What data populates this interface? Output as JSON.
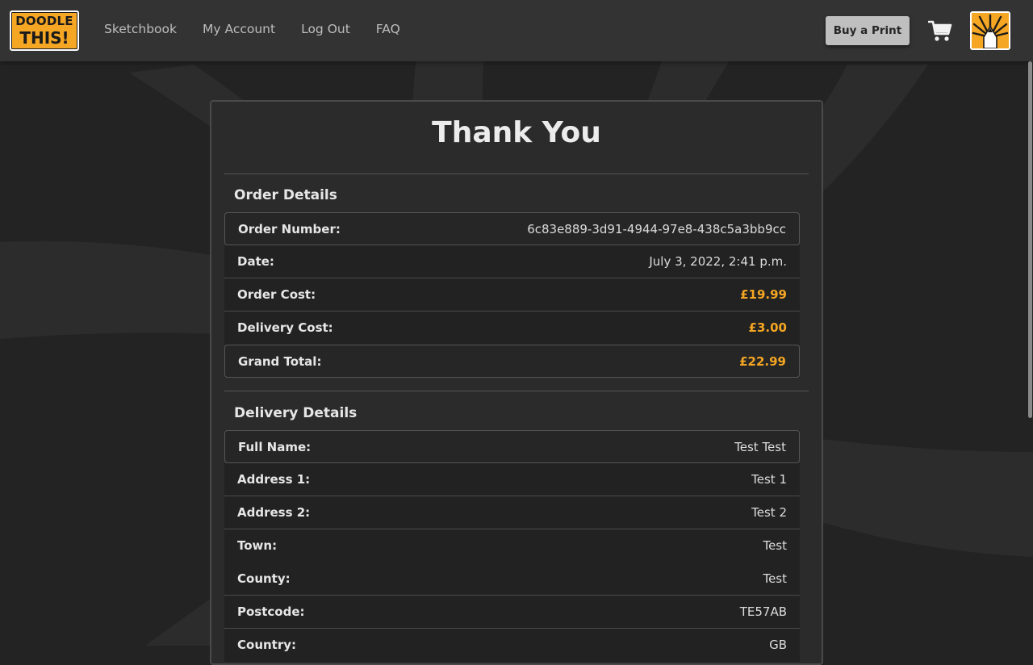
{
  "brand": {
    "line1": "DOODLE",
    "line2": "THIS!",
    "accent": "#f5a623"
  },
  "nav": {
    "links": [
      "Sketchbook",
      "My Account",
      "Log Out",
      "FAQ"
    ],
    "buy_label": "Buy a Print",
    "cart_icon": "cart-icon",
    "avatar_icon": "sunburst-pencil-icon"
  },
  "page": {
    "title": "Thank You"
  },
  "order": {
    "heading": "Order Details",
    "rows": [
      {
        "label": "Order Number:",
        "value": "6c83e889-3d91-4944-97e8-438c5a3bb9cc"
      },
      {
        "label": "Date:",
        "value": "July 3, 2022, 2:41 p.m."
      },
      {
        "label": "Order Cost:",
        "value": "£19.99"
      },
      {
        "label": "Delivery Cost:",
        "value": "£3.00"
      },
      {
        "label": "Grand Total:",
        "value": "£22.99"
      }
    ]
  },
  "delivery": {
    "heading": "Delivery Details",
    "rows": [
      {
        "label": "Full Name:",
        "value": "Test Test"
      },
      {
        "label": "Address 1:",
        "value": "Test 1"
      },
      {
        "label": "Address 2:",
        "value": "Test 2"
      },
      {
        "label": "Town:",
        "value": "Test"
      },
      {
        "label": "County:",
        "value": "Test"
      },
      {
        "label": "Postcode:",
        "value": "TE57AB"
      },
      {
        "label": "Country:",
        "value": "GB"
      }
    ]
  },
  "colors": {
    "background": "#232323",
    "navbar": "#333333",
    "card": "#2b2b2b",
    "money": "#f5a623"
  }
}
